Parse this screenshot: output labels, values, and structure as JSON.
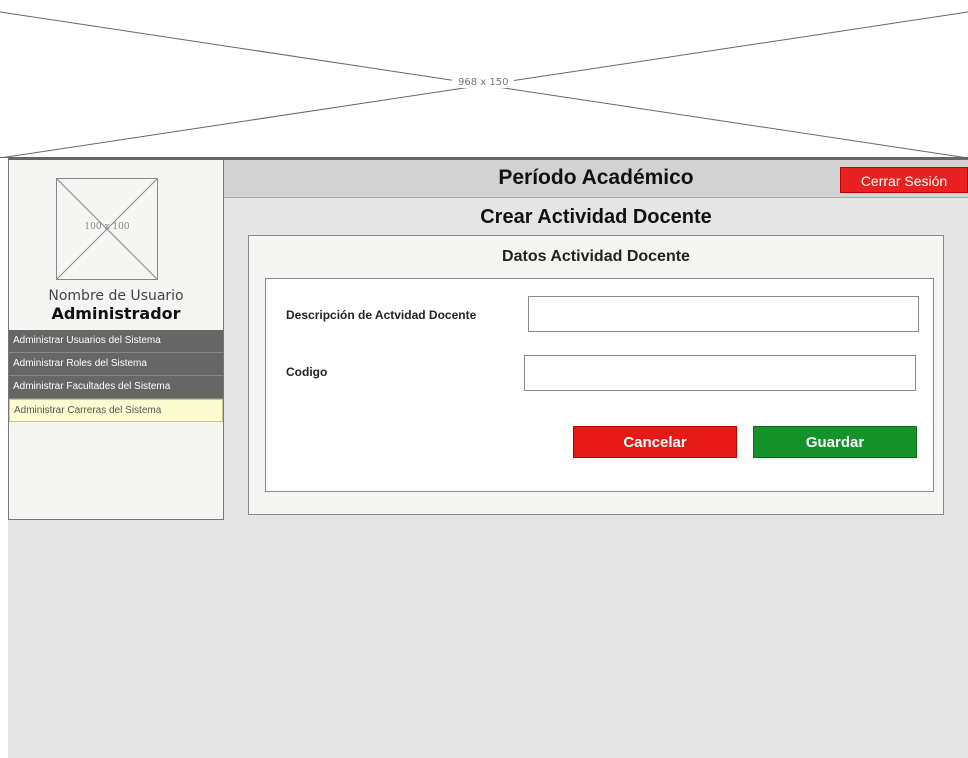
{
  "banner": {
    "placeholder_label": "968 x 150"
  },
  "sidebar": {
    "avatar_label": "100 x 100",
    "user_name": "Nombre de Usuario",
    "user_role": "Administrador",
    "menu": [
      {
        "label": "Administrar Usuarios del Sistema",
        "active": false
      },
      {
        "label": "Administrar Roles del Sistema",
        "active": false
      },
      {
        "label": "Administrar Facultades del Sistema",
        "active": false
      },
      {
        "label": "Administrar Carreras del Sistema",
        "active": true
      }
    ]
  },
  "header": {
    "title": "Período Académico",
    "logout_label": "Cerrar Sesión"
  },
  "main": {
    "page_title": "Crear Actividad Docente",
    "section_title": "Datos Actividad Docente",
    "form": {
      "description_label": "Descripción de Actvidad Docente",
      "description_value": "",
      "code_label": "Codigo",
      "code_value": ""
    },
    "cancel_label": "Cancelar",
    "save_label": "Guardar"
  },
  "colors": {
    "logout": "#e82020",
    "cancel": "#e81818",
    "save": "#16922a",
    "menu_bg": "#666666",
    "menu_active": "#fdfcd0"
  }
}
